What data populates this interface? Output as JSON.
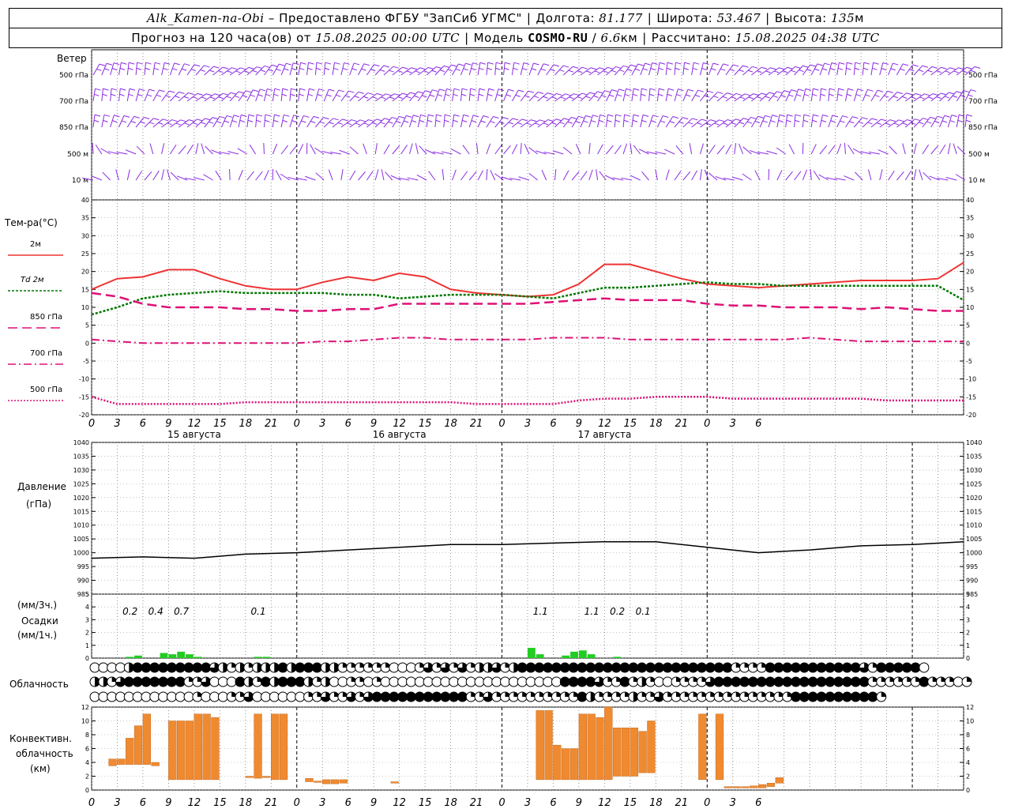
{
  "header": {
    "station": "Alk_Kamen-na-Obi",
    "provided_by": "– Предоставлено ФГБУ \"ЗапСиб УГМС\"",
    "lon_label": "Долгота:",
    "lon": "81.177",
    "lat_label": "Широта:",
    "lat": "53.467",
    "alt_label": "Высота:",
    "alt": "135",
    "alt_unit": "м",
    "forecast_label": "Прогноз на 120 часа(ов) от",
    "forecast_from": "15.08.2025 00:00 UTC",
    "model_label": "Модель",
    "model": "COSMO-RU",
    "model_res": "6.6",
    "model_res_unit": "км",
    "computed_label": "Рассчитано:",
    "computed": "15.08.2025 04:38 UTC"
  },
  "panels": {
    "wind": {
      "title": "Ветер",
      "levels": [
        "500 гПа",
        "700 гПа",
        "850 гПа",
        "500 м",
        "10 м"
      ],
      "color": "#8a2be2"
    },
    "temp": {
      "title": "Тем-ра(°C)",
      "legend": [
        "2м",
        "Td 2м",
        "850 гПа",
        "700 гПа",
        "500 гПа"
      ]
    },
    "pressure": {
      "title1": "Давление",
      "title2": "(гПа)"
    },
    "precip": {
      "unit3": "(мм/3ч.)",
      "title": "Осадки",
      "unit1": "(мм/1ч.)"
    },
    "cloud": {
      "title": "Облачность"
    },
    "conv": {
      "title1": "Конвективн.",
      "title2": "облачность",
      "title3": "(км)"
    }
  },
  "x_ticks": [
    "0",
    "3",
    "6",
    "9",
    "12",
    "15",
    "18",
    "21",
    "0",
    "3",
    "6",
    "9",
    "12",
    "15",
    "18",
    "21",
    "0",
    "3",
    "6",
    "9",
    "12",
    "15",
    "18",
    "21",
    "0",
    "3",
    "6"
  ],
  "days": [
    "15 августа",
    "16 августа",
    "17 августа"
  ],
  "colors": {
    "t2m": "#ee3333",
    "td2m": "#007700",
    "t850": "#dd1177",
    "t700": "#dd1177",
    "t500": "#dd1177",
    "pressure": "#000000",
    "precip": "#22cc22",
    "conv": "#f08a30"
  },
  "chart_data": [
    {
      "type": "line",
      "title": "Тем-ра(°C)",
      "x_hours": [
        0,
        3,
        6,
        9,
        12,
        15,
        18,
        21,
        24,
        27,
        30,
        33,
        36,
        39,
        42,
        45,
        48,
        51,
        54,
        57,
        60,
        63,
        66,
        69,
        72,
        75,
        78,
        81,
        84,
        87,
        90,
        93,
        96,
        99,
        102
      ],
      "ylim": [
        -20,
        40
      ],
      "series": [
        {
          "name": "2м",
          "values": [
            15,
            18,
            18.5,
            20.5,
            20.5,
            18,
            16,
            15,
            15,
            17,
            18.5,
            17.5,
            19.5,
            18.5,
            15,
            14,
            13.5,
            13,
            13.5,
            16.5,
            22,
            22,
            20,
            18,
            16.5,
            16,
            15.5,
            16,
            16.5,
            17,
            17.5,
            17.5,
            17.5,
            18,
            22.5
          ]
        },
        {
          "name": "Td 2м",
          "values": [
            8,
            10,
            12.5,
            13.5,
            14,
            14.5,
            14,
            14,
            14,
            14,
            13.5,
            13.5,
            12.5,
            13,
            13.5,
            13.5,
            13.5,
            13,
            12.5,
            14,
            15.5,
            15.5,
            16,
            16.5,
            17,
            16.5,
            16.5,
            16,
            16,
            16,
            16,
            16,
            16,
            16,
            12
          ]
        },
        {
          "name": "850 гПа",
          "values": [
            14,
            13,
            11,
            10,
            10,
            10,
            9.5,
            9.5,
            9,
            9,
            9.5,
            9.5,
            11,
            11,
            11,
            11,
            11,
            11,
            11.5,
            12,
            12.5,
            12,
            12,
            12,
            11,
            10.5,
            10.5,
            10,
            10,
            10,
            9.5,
            10,
            9.5,
            9,
            9
          ]
        },
        {
          "name": "700 гПа",
          "values": [
            1,
            0.5,
            0,
            0,
            0,
            0,
            0,
            0,
            0,
            0.5,
            0.5,
            1,
            1.5,
            1.5,
            1,
            1,
            1,
            1,
            1.5,
            1.5,
            1.5,
            1,
            1,
            1,
            1,
            1,
            1,
            1,
            1.5,
            1,
            0.5,
            0.5,
            0.5,
            0.5,
            0.5
          ]
        },
        {
          "name": "500 гПа",
          "values": [
            -15,
            -17,
            -17,
            -17,
            -17,
            -17,
            -16.5,
            -16.5,
            -16.5,
            -16.5,
            -16.5,
            -16.5,
            -16.5,
            -16.5,
            -16.5,
            -17,
            -17,
            -17,
            -17,
            -16,
            -15.5,
            -15.5,
            -15,
            -15,
            -15,
            -15.5,
            -15.5,
            -15.5,
            -15.5,
            -15.5,
            -15.5,
            -16,
            -16,
            -16,
            -16
          ]
        }
      ]
    },
    {
      "type": "line",
      "title": "Давление (гПа)",
      "x_hours": [
        0,
        6,
        12,
        18,
        24,
        30,
        36,
        42,
        48,
        54,
        60,
        66,
        72,
        78,
        84,
        90,
        96,
        102
      ],
      "ylim": [
        985,
        1040
      ],
      "series": [
        {
          "name": "",
          "values": [
            998,
            998.5,
            998,
            999.5,
            1000,
            1001,
            1002,
            1003,
            1003,
            1003.5,
            1004,
            1004,
            1002,
            1000,
            1001,
            1002.5,
            1003,
            1004
          ]
        }
      ]
    },
    {
      "type": "bar",
      "title": "Осадки",
      "ylim": [
        0,
        5
      ],
      "hours": [
        4,
        5,
        8,
        9,
        10,
        11,
        12,
        19,
        20,
        51,
        52,
        55,
        56,
        57,
        58,
        61
      ],
      "values": [
        0.1,
        0.2,
        0.4,
        0.3,
        0.5,
        0.3,
        0.1,
        0.1,
        0.1,
        0.8,
        0.3,
        0.2,
        0.5,
        0.6,
        0.3,
        0.1
      ],
      "labels_3h": [
        {
          "hour": 4.5,
          "text": "0.2"
        },
        {
          "hour": 7.5,
          "text": "0.4"
        },
        {
          "hour": 10.5,
          "text": "0.7"
        },
        {
          "hour": 19.5,
          "text": "0.1"
        },
        {
          "hour": 52.5,
          "text": "1.1"
        },
        {
          "hour": 58.5,
          "text": "1.1"
        },
        {
          "hour": 61.5,
          "text": "0.2"
        },
        {
          "hour": 64.5,
          "text": "0.1"
        }
      ]
    },
    {
      "type": "bar",
      "title": "Конвективн. облачность (км)",
      "ylim": [
        0,
        12
      ],
      "bars": [
        [
          2,
          4.5,
          3.5
        ],
        [
          3,
          4.5,
          3.7
        ],
        [
          4,
          7.5,
          3.7
        ],
        [
          5,
          9.3,
          3.7
        ],
        [
          6,
          11,
          3.7
        ],
        [
          7,
          4,
          3.5
        ],
        [
          9,
          10,
          1.5
        ],
        [
          10,
          10,
          1.5
        ],
        [
          11,
          10,
          1.5
        ],
        [
          12,
          11,
          1.5
        ],
        [
          13,
          11,
          1.5
        ],
        [
          14,
          10.5,
          1.5
        ],
        [
          18,
          2,
          1.8
        ],
        [
          19,
          11,
          1.7
        ],
        [
          20,
          2,
          1.8
        ],
        [
          21,
          11,
          1.5
        ],
        [
          22,
          11,
          1.5
        ],
        [
          25,
          1.7,
          1.2
        ],
        [
          26,
          1.3,
          1.1
        ],
        [
          27,
          1.5,
          0.9
        ],
        [
          28,
          1.5,
          0.9
        ],
        [
          29,
          1.5,
          1
        ],
        [
          35,
          1.2,
          1
        ],
        [
          52,
          11.5,
          1.5
        ],
        [
          53,
          11.5,
          1.5
        ],
        [
          54,
          6.5,
          1.5
        ],
        [
          55,
          6,
          1.5
        ],
        [
          56,
          6,
          1.5
        ],
        [
          57,
          11,
          1.5
        ],
        [
          58,
          11,
          1.5
        ],
        [
          59,
          10.5,
          1.5
        ],
        [
          60,
          12,
          1.5
        ],
        [
          61,
          9,
          2
        ],
        [
          62,
          9,
          2
        ],
        [
          63,
          9,
          2
        ],
        [
          64,
          8.5,
          2.5
        ],
        [
          65,
          10,
          2.5
        ],
        [
          71,
          11,
          1.5
        ],
        [
          73,
          11,
          1.5
        ],
        [
          74,
          0.5,
          0.3
        ],
        [
          75,
          0.5,
          0.3
        ],
        [
          76,
          0.5,
          0.3
        ],
        [
          77,
          0.6,
          0.3
        ],
        [
          78,
          0.8,
          0.3
        ],
        [
          79,
          1,
          0.5
        ],
        [
          80,
          1.8,
          1
        ]
      ]
    },
    {
      "type": "table",
      "title": "Облачность",
      "rows": [
        "oooohfffffffffwhqhqhhhfhfffhhqqqqqqoooqwqwqwqhhwqhfffffffffffffffffffffffffqqqqfffffffffffwqfffffo",
        "hhqwfffffffqqwooofhqfhfffhqhooqqoqoooooooooooooooooooooffffwqqfqhqooqqqqwffffffffffffffffffqqqqqqfqqqoqffwoo",
        "ooooooooooooqoooqqwooooooqqwqqwqwfffffffffffqqwqqqqqqqqqqfhqqqqhqqwqqqqqqqqqqqqqqqffffffffffq"
      ]
    }
  ]
}
